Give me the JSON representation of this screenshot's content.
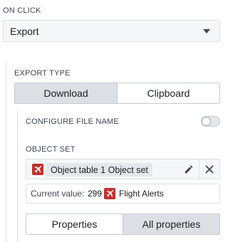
{
  "on_click": {
    "label": "ON CLICK",
    "selected": "Export"
  },
  "export_type": {
    "label": "EXPORT TYPE",
    "options": [
      "Download",
      "Clipboard"
    ],
    "active_index": 0
  },
  "configure_file_name": {
    "label": "CONFIGURE FILE NAME",
    "enabled": false
  },
  "object_set": {
    "label": "OBJECT SET",
    "tag": "Object table 1 Object set",
    "current_value_label": "Current value:",
    "current_value_count": "299",
    "current_value_type": "Flight Alerts",
    "icon": "airplane-icon",
    "icon_color": "#c23030"
  },
  "columns_mode": {
    "options": [
      "Properties",
      "All properties"
    ],
    "active_index": 1
  }
}
